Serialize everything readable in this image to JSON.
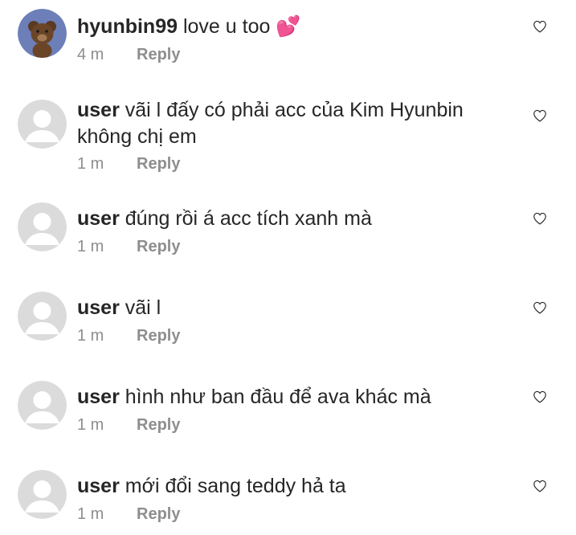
{
  "comments": [
    {
      "username": "hyunbin99",
      "text": "love u too 💕",
      "time": "4 m",
      "reply": "Reply",
      "avatar": "teddy-bear"
    },
    {
      "username": "user",
      "text": "vãi l đấy có phải acc của Kim Hyunbin không chị em",
      "time": "1 m",
      "reply": "Reply",
      "avatar": "default"
    },
    {
      "username": "user",
      "text": "đúng rồi á acc tích xanh mà",
      "time": "1 m",
      "reply": "Reply",
      "avatar": "default"
    },
    {
      "username": "user",
      "text": "vãi l",
      "time": "1 m",
      "reply": "Reply",
      "avatar": "default"
    },
    {
      "username": "user",
      "text": "hình như ban đầu để ava khác mà",
      "time": "1 m",
      "reply": "Reply",
      "avatar": "default"
    },
    {
      "username": "user",
      "text": "mới đổi sang teddy hả ta",
      "time": "1 m",
      "reply": "Reply",
      "avatar": "default"
    }
  ],
  "icons": {
    "like": "heart-outline-icon",
    "avatar_default": "default-avatar-icon",
    "avatar_teddy": "teddy-bear-avatar"
  },
  "colors": {
    "text": "#262626",
    "muted": "#8e8e8e",
    "avatar_placeholder": "#dbdbdb",
    "teddy_bg": "#6c7fb8"
  }
}
